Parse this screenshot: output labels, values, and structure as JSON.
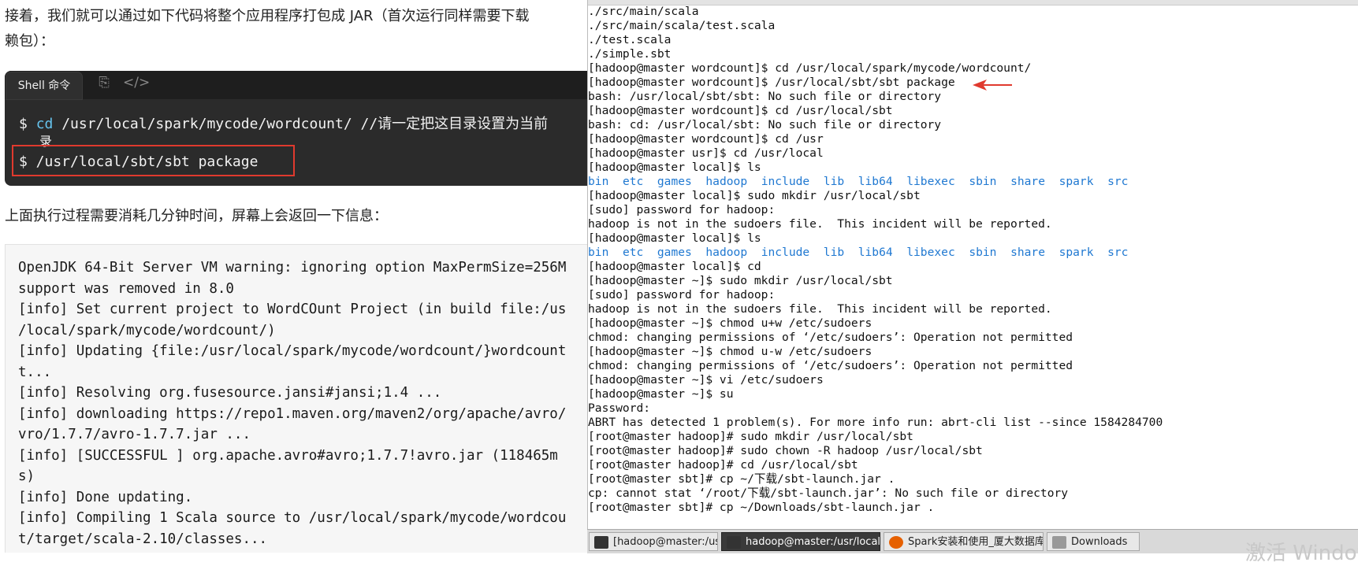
{
  "article": {
    "para1_line1": "接着，我们就可以通过如下代码将整个应用程序打包成 JAR（首次运行同样需要下载",
    "para1_line2": "赖包）：",
    "code_tab_label": "Shell 命令",
    "copy_icon": "copy-icon",
    "code_icon": "code-icon",
    "code_prompt1": "$ ",
    "code_cmd1_kw": "cd",
    "code_cmd1_rest": " /usr/local/spark/mycode/wordcount/  //请一定把这目录设置为当前",
    "code_cmd1_wrap": "录",
    "code_line2": "$ /usr/local/sbt/sbt package",
    "para2": "上面执行过程需要消耗几分钟时间，屏幕上会返回一下信息：",
    "output_lines": [
      "OpenJDK 64-Bit Server VM warning: ignoring option MaxPermSize=256M",
      "support was removed in 8.0",
      "[info] Set current project to WordCOunt Project (in build file:/us",
      "/local/spark/mycode/wordcount/)",
      "[info] Updating {file:/usr/local/spark/mycode/wordcount/}wordcount",
      "t...",
      "[info] Resolving org.fusesource.jansi#jansi;1.4 ...",
      "[info] downloading https://repo1.maven.org/maven2/org/apache/avro/",
      "vro/1.7.7/avro-1.7.7.jar ...",
      "[info]  [SUCCESSFUL ] org.apache.avro#avro;1.7.7!avro.jar (118465m",
      "s)",
      "[info] Done updating.",
      "[info] Compiling 1 Scala source to /usr/local/spark/mycode/wordcou",
      "t/target/scala-2.10/classes..."
    ]
  },
  "terminal": {
    "lines": [
      {
        "text": "./src/main/scala"
      },
      {
        "text": "./src/main/scala/test.scala"
      },
      {
        "text": "./test.scala"
      },
      {
        "text": "./simple.sbt"
      },
      {
        "text": "[hadoop@master wordcount]$ cd /usr/local/spark/mycode/wordcount/"
      },
      {
        "text": "[hadoop@master wordcount]$ /usr/local/sbt/sbt package"
      },
      {
        "text": "bash: /usr/local/sbt/sbt: No such file or directory"
      },
      {
        "text": "[hadoop@master wordcount]$ cd /usr/local/sbt"
      },
      {
        "text": "bash: cd: /usr/local/sbt: No such file or directory"
      },
      {
        "text": "[hadoop@master wordcount]$ cd /usr"
      },
      {
        "text": "[hadoop@master usr]$ cd /usr/local"
      },
      {
        "text": "[hadoop@master local]$ ls"
      },
      {
        "dirs": [
          "bin",
          "etc",
          "games",
          "hadoop",
          "include",
          "lib",
          "lib64",
          "libexec",
          "sbin",
          "share",
          "spark",
          "src"
        ]
      },
      {
        "text": "[hadoop@master local]$ sudo mkdir /usr/local/sbt"
      },
      {
        "text": "[sudo] password for hadoop:"
      },
      {
        "text": "hadoop is not in the sudoers file.  This incident will be reported."
      },
      {
        "text": "[hadoop@master local]$ ls"
      },
      {
        "dirs": [
          "bin",
          "etc",
          "games",
          "hadoop",
          "include",
          "lib",
          "lib64",
          "libexec",
          "sbin",
          "share",
          "spark",
          "src"
        ]
      },
      {
        "text": "[hadoop@master local]$ cd"
      },
      {
        "text": "[hadoop@master ~]$ sudo mkdir /usr/local/sbt"
      },
      {
        "text": "[sudo] password for hadoop:"
      },
      {
        "text": "hadoop is not in the sudoers file.  This incident will be reported."
      },
      {
        "text": "[hadoop@master ~]$ chmod u+w /etc/sudoers"
      },
      {
        "text": "chmod: changing permissions of ‘/etc/sudoers’: Operation not permitted"
      },
      {
        "text": "[hadoop@master ~]$ chmod u-w /etc/sudoers"
      },
      {
        "text": "chmod: changing permissions of ‘/etc/sudoers’: Operation not permitted"
      },
      {
        "text": "[hadoop@master ~]$ vi /etc/sudoers"
      },
      {
        "text": "[hadoop@master ~]$ su"
      },
      {
        "text": "Password:"
      },
      {
        "text": "ABRT has detected 1 problem(s). For more info run: abrt-cli list --since 1584284700"
      },
      {
        "text": "[root@master hadoop]# sudo mkdir /usr/local/sbt"
      },
      {
        "text": "[root@master hadoop]# sudo chown -R hadoop /usr/local/sbt"
      },
      {
        "text": "[root@master hadoop]# cd /usr/local/sbt"
      },
      {
        "text": "[root@master sbt]# cp ~/下载/sbt-launch.jar ."
      },
      {
        "text": "cp: cannot stat ‘/root/下载/sbt-launch.jar’: No such file or directory"
      },
      {
        "text": "[root@master sbt]# cp ~/Downloads/sbt-launch.jar ."
      }
    ]
  },
  "taskbar": {
    "items": [
      {
        "label": "[hadoop@master:/usr/local/s...",
        "icon": "terminal-icon",
        "active": false
      },
      {
        "label": "hadoop@master:/usr/local/sbt",
        "icon": "terminal-icon",
        "active": true
      },
      {
        "label": "Spark安装和使用_厦大数据库...",
        "icon": "firefox-icon",
        "active": false
      },
      {
        "label": "Downloads",
        "icon": "folder-icon",
        "active": false
      }
    ],
    "watermark": "激活 Windows"
  },
  "colors": {
    "dir_blue": "#1f78d1",
    "highlight_red": "#e03a2e",
    "code_bg": "#2b2b2b",
    "keyword": "#66c4ee"
  }
}
